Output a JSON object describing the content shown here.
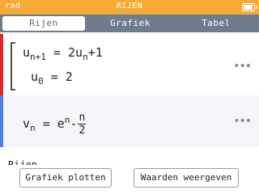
{
  "titlebar": {
    "mode": "rad",
    "app_title": "RIJEN",
    "battery_icon": "battery-icon"
  },
  "tabs": [
    {
      "label": "Rijen",
      "active": true
    },
    {
      "label": "Grafiek",
      "active": false
    },
    {
      "label": "Tabel",
      "active": false
    }
  ],
  "sequences": [
    {
      "name": "u",
      "color": "#e8242b",
      "recurrence": {
        "lhs_base": "u",
        "lhs_index": "n+1",
        "eq": "=",
        "rhs_coeff": "2u",
        "rhs_index": "n",
        "rhs_tail": "+1"
      },
      "initial": {
        "base": "u",
        "index": "0",
        "eq": "=",
        "value": "2"
      },
      "menu_icon": "more-icon"
    },
    {
      "name": "v",
      "color": "#4a7de8",
      "definition": {
        "lhs_base": "v",
        "lhs_index": "n",
        "eq": "=",
        "e_base": "e",
        "e_exp": "n",
        "minus": "-",
        "frac_num": "n",
        "frac_den": "2"
      },
      "menu_icon": "more-icon"
    }
  ],
  "more_glyph": "•••",
  "peek_text": "Rijen",
  "buttons": {
    "plot": "Grafiek plotten",
    "values": "Waarden weergeven"
  },
  "colors": {
    "titlebar": "#f5ab33",
    "tabbar": "#707b8c"
  }
}
